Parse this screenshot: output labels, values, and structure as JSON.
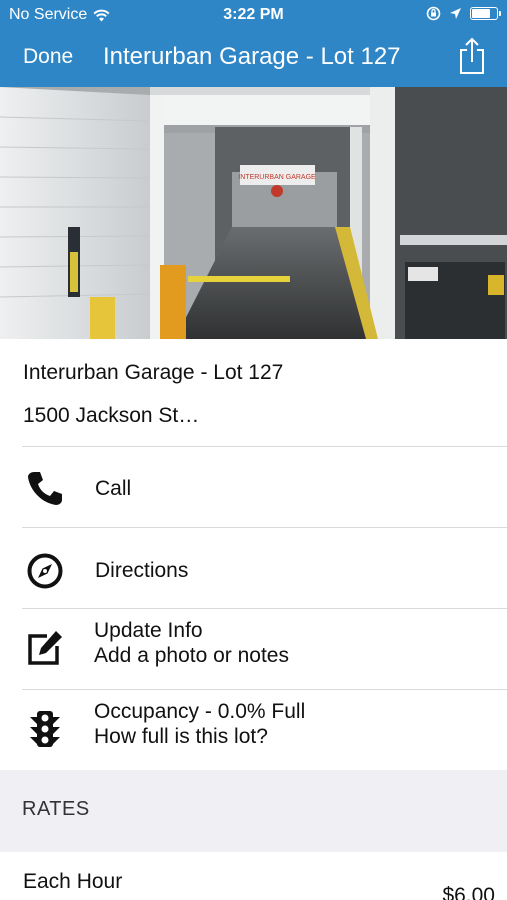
{
  "status_bar": {
    "carrier": "No Service",
    "time": "3:22 PM",
    "battery_level": 0.75
  },
  "nav": {
    "done_label": "Done",
    "title": "Interurban Garage - Lot 127",
    "share_icon": "share-icon"
  },
  "photo": {
    "sign_text": "INTERURBAN GARAGE"
  },
  "lot": {
    "name": "Interurban Garage - Lot 127",
    "address": "1500 Jackson St…"
  },
  "actions": [
    {
      "icon": "phone-icon",
      "label": "Call"
    },
    {
      "icon": "compass-icon",
      "label": "Directions"
    },
    {
      "icon": "edit-icon",
      "label": "Update Info",
      "sublabel": "Add a photo or notes"
    },
    {
      "icon": "traffic-light-icon",
      "label": "Occupancy - 0.0% Full",
      "sublabel": "How full is this lot?"
    }
  ],
  "rates": {
    "header": "RATES",
    "items": [
      {
        "label": "Each Hour",
        "price": "$6.00"
      }
    ]
  },
  "colors": {
    "header_bg": "#2e86c6",
    "section_bg": "#efeff4",
    "separator": "#d9d9d9"
  }
}
